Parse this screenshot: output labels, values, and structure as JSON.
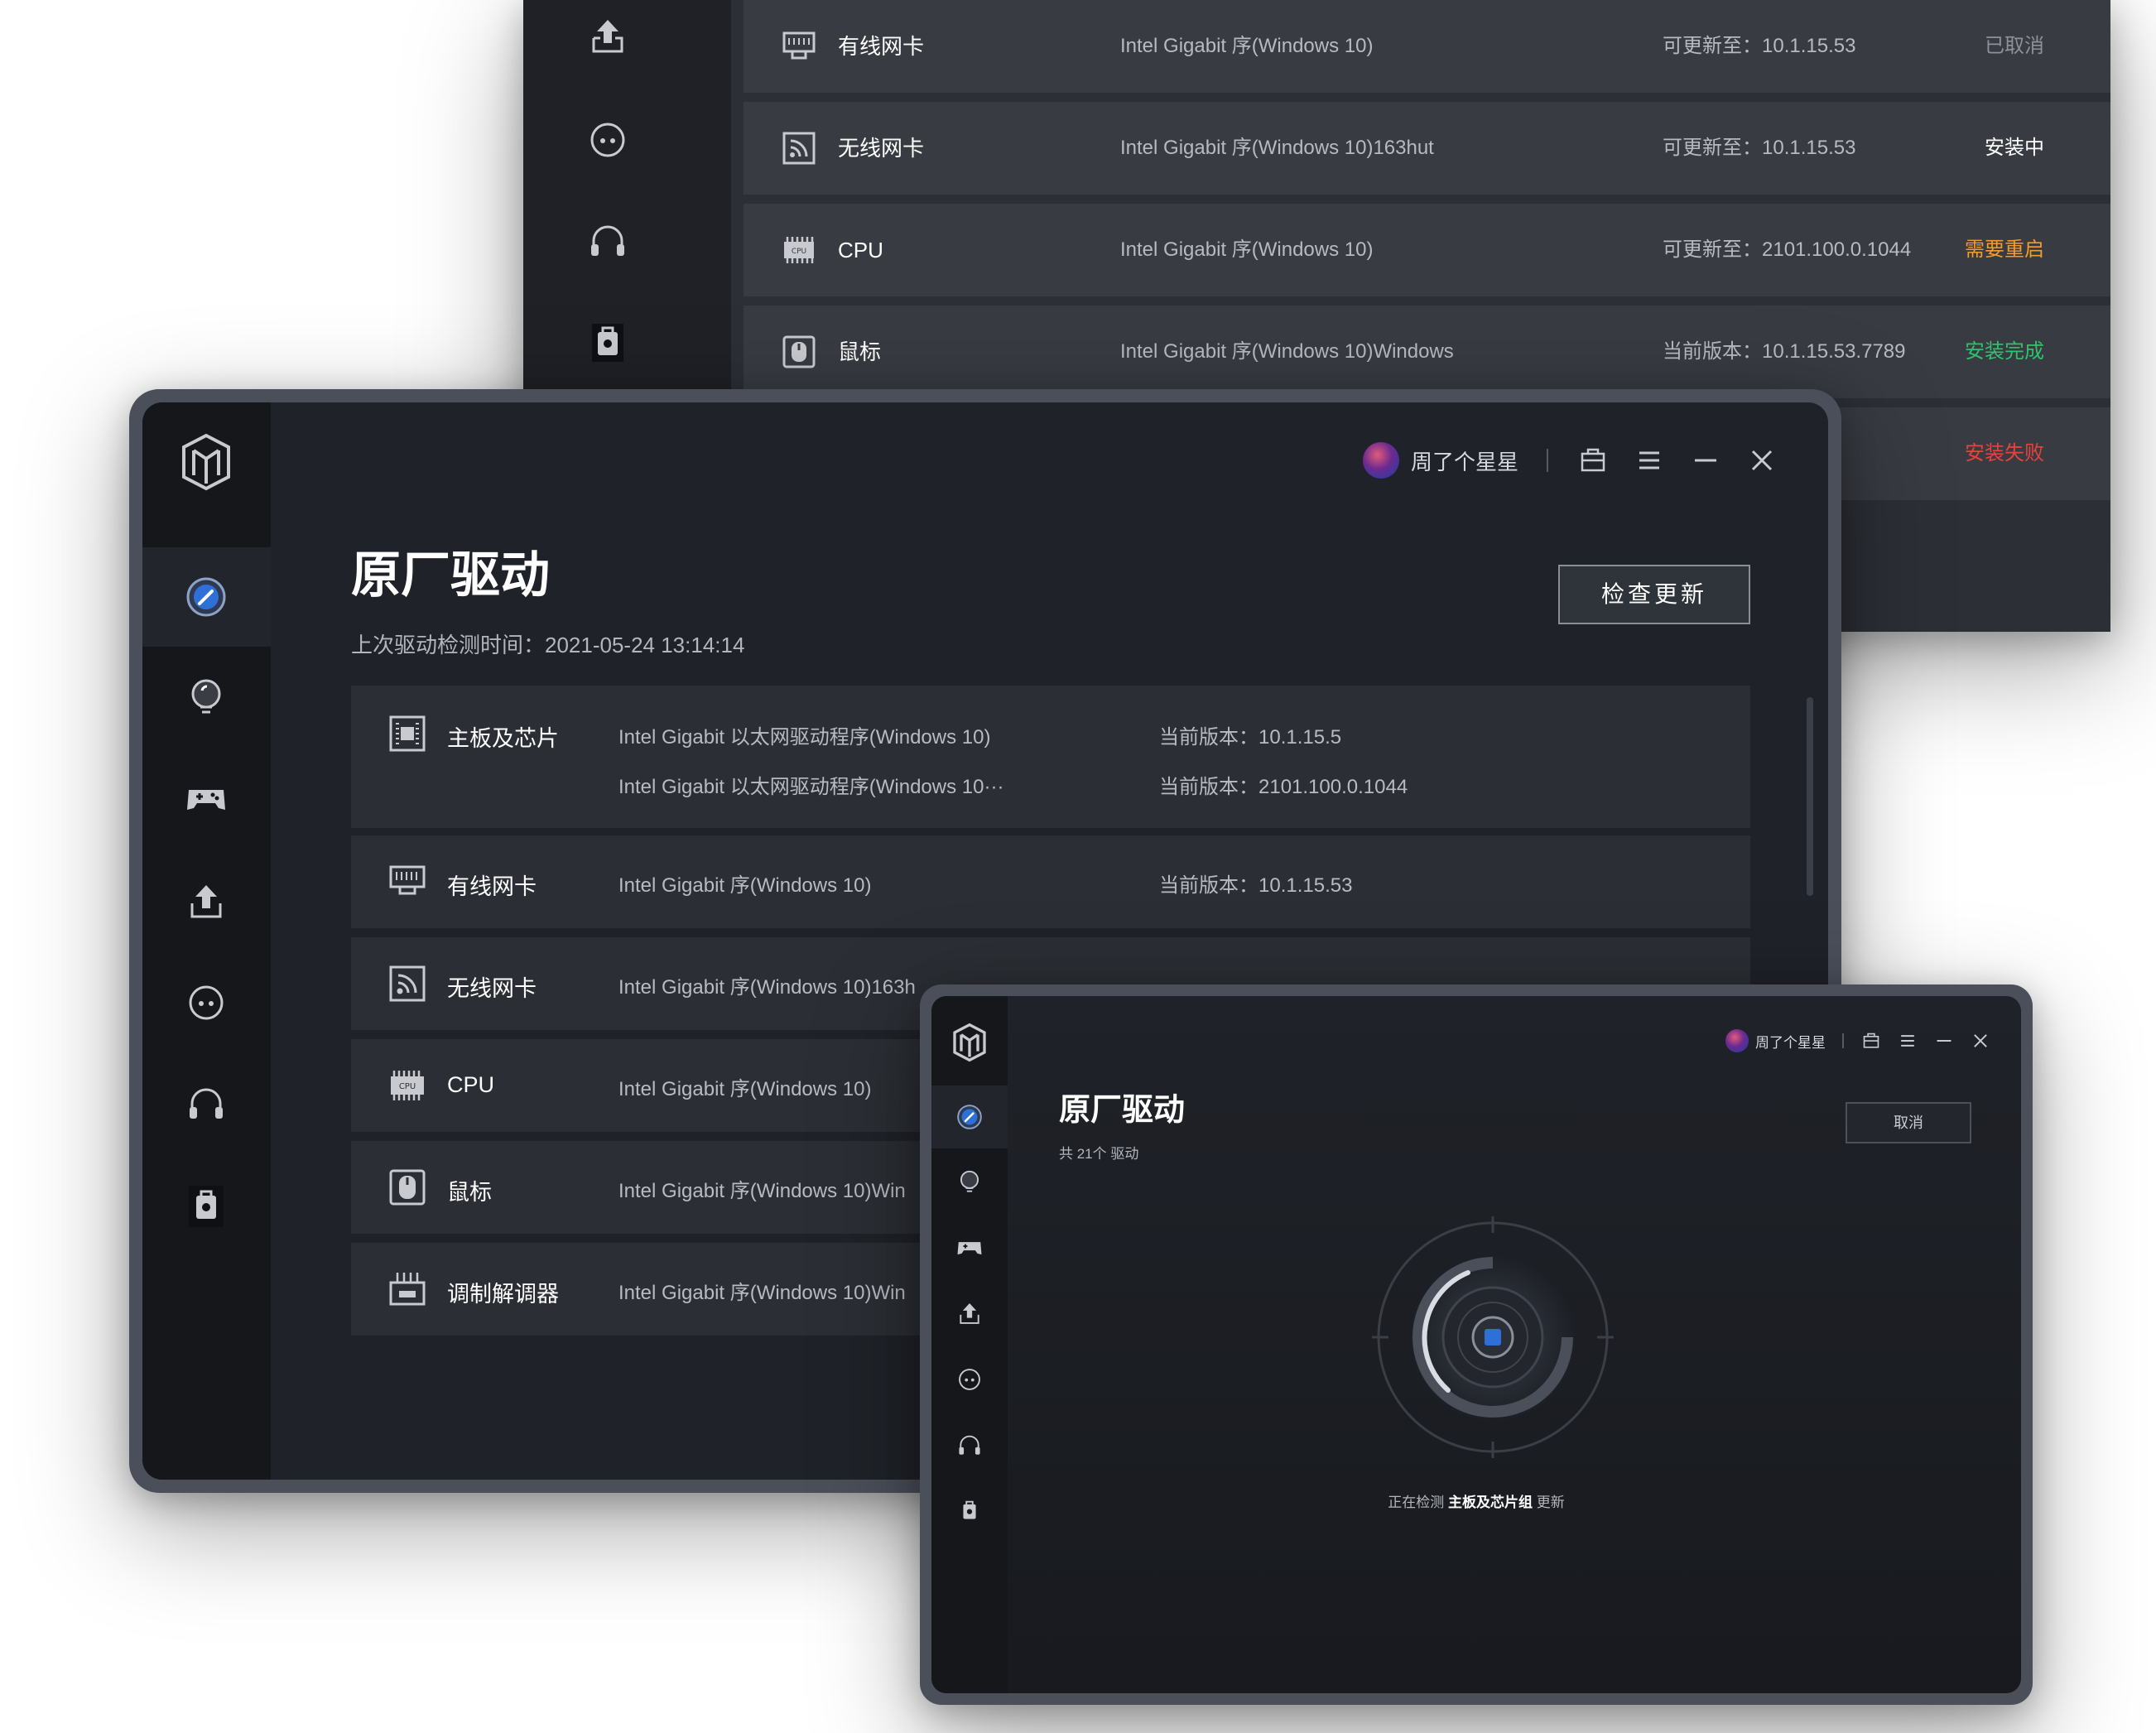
{
  "back_window": {
    "rows": [
      {
        "icon": "ethernet-card-icon",
        "name": "有线网卡",
        "desc": "Intel Gigabit 序(Windows 10)",
        "version": "可更新至：10.1.15.53",
        "status": "已取消",
        "status_color": "#8e9199"
      },
      {
        "icon": "wireless-card-icon",
        "name": "无线网卡",
        "desc": "Intel Gigabit 序(Windows 10)163hut",
        "version": "可更新至：10.1.15.53",
        "status": "安装中",
        "status_color": "#ffffff"
      },
      {
        "icon": "cpu-icon",
        "name": "CPU",
        "desc": "Intel Gigabit 序(Windows 10)",
        "version": "可更新至：2101.100.0.1044",
        "status": "需要重启",
        "status_color": "#f39c2d"
      },
      {
        "icon": "mouse-icon",
        "name": "鼠标",
        "desc": "Intel Gigabit 序(Windows 10)Windows",
        "version": "当前版本：10.1.15.53.7789",
        "status": "安装完成",
        "status_color": "#2fc26c"
      },
      {
        "icon": "",
        "name": "",
        "desc": "",
        "version": "",
        "status": "安装失败",
        "status_color": "#e5433b"
      }
    ]
  },
  "main_window": {
    "user": {
      "name": "周了个星星"
    },
    "title": "原厂驱动",
    "subtitle": "上次驱动检测时间：2021-05-24  13:14:14",
    "check_button": "检查更新",
    "rows": [
      {
        "icon": "motherboard-icon",
        "name": "主板及芯片",
        "lines": [
          {
            "desc": "Intel Gigabit 以太网驱动程序(Windows 10)",
            "version": "当前版本：10.1.15.5"
          },
          {
            "desc": "Intel Gigabit 以太网驱动程序(Windows 10···",
            "version": "当前版本：2101.100.0.1044"
          }
        ]
      },
      {
        "icon": "ethernet-card-icon",
        "name": "有线网卡",
        "desc": "Intel Gigabit 序(Windows 10)",
        "version": "当前版本：10.1.15.53"
      },
      {
        "icon": "wireless-card-icon",
        "name": "无线网卡",
        "desc": "Intel Gigabit 序(Windows 10)163h",
        "version": ""
      },
      {
        "icon": "cpu-icon",
        "name": "CPU",
        "desc": "Intel Gigabit 序(Windows 10)",
        "version": ""
      },
      {
        "icon": "mouse-icon",
        "name": "鼠标",
        "desc": "Intel Gigabit 序(Windows 10)Win",
        "version": ""
      },
      {
        "icon": "modem-icon",
        "name": "调制解调器",
        "desc": "Intel Gigabit 序(Windows 10)Win",
        "version": ""
      }
    ]
  },
  "small_window": {
    "user": {
      "name": "周了个星星"
    },
    "title": "原厂驱动",
    "subtitle": "共 21个 驱动",
    "cancel_button": "取消",
    "status_prefix": "正在检测",
    "status_target": "主板及芯片组",
    "status_suffix": "更新"
  },
  "sidebar_icons": [
    "speedometer-icon",
    "bulb-icon",
    "gamepad-icon",
    "upload-icon",
    "chat-icon",
    "headset-icon",
    "toolbox-icon"
  ],
  "colors": {
    "accent": "#2f6fd8",
    "bg_dark": "#1f2228",
    "row_bg": "#2b2e34"
  }
}
